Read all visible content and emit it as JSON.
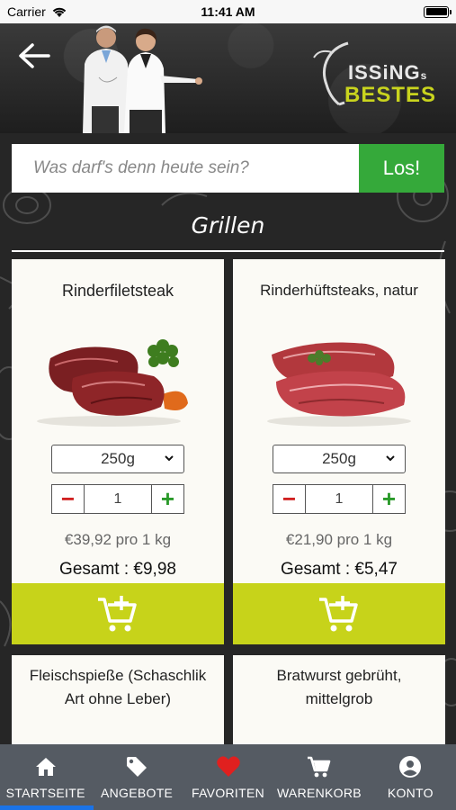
{
  "status_bar": {
    "carrier": "Carrier",
    "time": "11:41 AM"
  },
  "header": {
    "logo_line1": "ISSiNG",
    "logo_line1_suffix": "s",
    "logo_line2": "BESTES"
  },
  "search": {
    "placeholder": "Was darf's denn heute sein?",
    "button_label": "Los!"
  },
  "section": {
    "title": "Grillen"
  },
  "products": [
    {
      "name": "Rinderfiletsteak",
      "weight": "250g",
      "quantity": "1",
      "unit_price": "€39,92 pro 1 kg",
      "total": "Gesamt : €9,98"
    },
    {
      "name": "Rinderhüftsteaks, natur",
      "weight": "250g",
      "quantity": "1",
      "unit_price": "€21,90 pro 1 kg",
      "total": "Gesamt : €5,47"
    },
    {
      "name": "Fleischspieße (Schaschlik Art ohne Leber)"
    },
    {
      "name": "Bratwurst gebrüht, mittelgrob"
    }
  ],
  "tabbar": {
    "items": [
      {
        "label": "STARTSEITE",
        "icon": "home-icon"
      },
      {
        "label": "ANGEBOTE",
        "icon": "tag-icon"
      },
      {
        "label": "FAVORITEN",
        "icon": "heart-icon"
      },
      {
        "label": "WARENKORB",
        "icon": "cart-icon"
      },
      {
        "label": "KONTO",
        "icon": "account-icon"
      }
    ]
  },
  "colors": {
    "accent_green": "#35a93a",
    "cart_yellow": "#c7d31a",
    "minus_red": "#d02020",
    "heart_red": "#e0201f",
    "tabbar": "#555b63"
  }
}
